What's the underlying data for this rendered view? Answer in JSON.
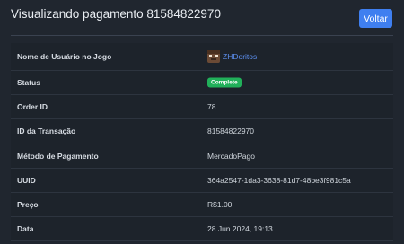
{
  "header": {
    "title": "Visualizando pagamento 81584822970",
    "back_label": "Voltar"
  },
  "details": {
    "username_label": "Nome de Usuário no Jogo",
    "username": "ZHDoritos",
    "status_label": "Status",
    "status": "Complete",
    "status_color": "#21b05a",
    "order_id_label": "Order ID",
    "order_id": "78",
    "transaction_id_label": "ID da Transação",
    "transaction_id": "81584822970",
    "payment_method_label": "Método de Pagamento",
    "payment_method": "MercadoPago",
    "uuid_label": "UUID",
    "uuid": "364a2547-1da3-3638-81d7-48be3f981c5a",
    "price_label": "Preço",
    "price": "R$1.00",
    "date_label": "Data",
    "date": "28 Jun 2024, 19:13"
  },
  "colors": {
    "accent": "#3f7ff0",
    "link": "#5c8ff0",
    "background": "#20262f"
  }
}
